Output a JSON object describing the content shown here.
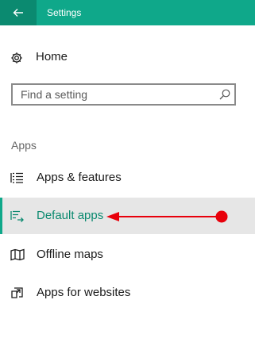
{
  "window": {
    "title": "Settings"
  },
  "home": {
    "label": "Home"
  },
  "search": {
    "placeholder": "Find a setting",
    "value": ""
  },
  "section": {
    "header": "Apps"
  },
  "nav": {
    "items": [
      {
        "label": "Apps & features",
        "icon": "list-icon",
        "selected": false
      },
      {
        "label": "Default apps",
        "icon": "default-apps-icon",
        "selected": true
      },
      {
        "label": "Offline maps",
        "icon": "map-icon",
        "selected": false
      },
      {
        "label": "Apps for websites",
        "icon": "open-in-icon",
        "selected": false
      }
    ]
  },
  "colors": {
    "accent": "#0fa88a",
    "accent_dark": "#0b8a70",
    "selected_bg": "#e6e6e6",
    "annotation": "#e8000b"
  }
}
